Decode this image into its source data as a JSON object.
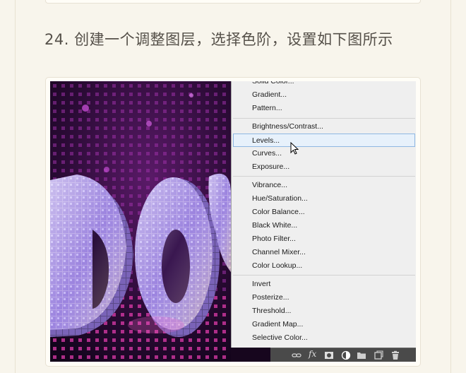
{
  "heading": {
    "text": "24. 创建一个调整图层，选择色阶，设置如下图所示"
  },
  "adjustment_menu": {
    "items": [
      "Solid Color...",
      "Gradient...",
      "Pattern...",
      "Brightness/Contrast...",
      "Levels...",
      "Curves...",
      "Exposure...",
      "Vibrance...",
      "Hue/Saturation...",
      "Color Balance...",
      "Black  White...",
      "Photo Filter...",
      "Channel Mixer...",
      "Color Lookup...",
      "Invert",
      "Posterize...",
      "Threshold...",
      "Gradient Map...",
      "Selective Color..."
    ],
    "highlighted": "Levels..."
  },
  "layers_panel_bar": {
    "fx_label": "fx",
    "icons": [
      "link-icon",
      "fx-icon",
      "layer-mask-icon",
      "adjustment-layer-icon",
      "folder-icon",
      "new-layer-icon",
      "trash-icon"
    ]
  },
  "colors": {
    "page_background": "#f8f5ec",
    "heading_text": "#555049",
    "menu_background": "#efefef",
    "menu_highlight": "#e7f1fb",
    "menu_highlight_border": "#8fb8e3",
    "panel_bar": "#4a4a4a"
  }
}
